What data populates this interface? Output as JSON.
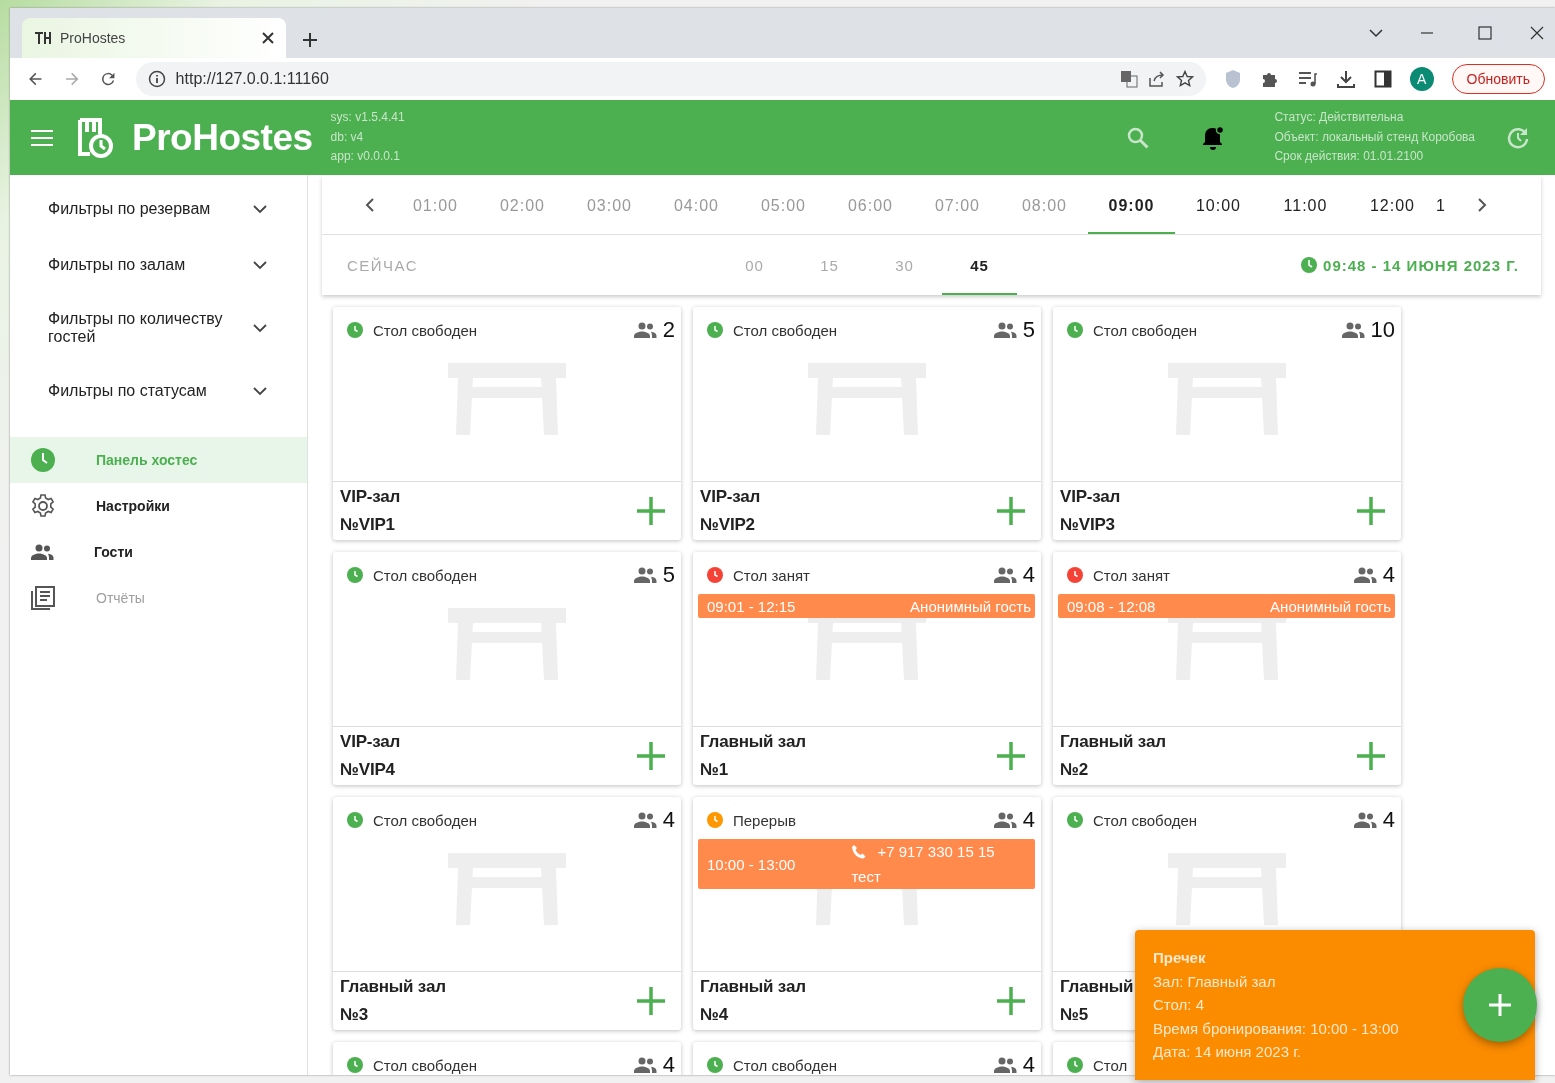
{
  "browser": {
    "tab_title": "ProHostes",
    "url": "http://127.0.0.1:11160",
    "profile_initial": "A",
    "update_button": "Обновить"
  },
  "header": {
    "app_name": "ProHostes",
    "versions": [
      "sys: v1.5.4.41",
      "db: v4",
      "app: v0.0.0.1"
    ],
    "license": [
      "Статус: Действительна",
      "Объект: локальный стенд Коробова",
      "Срок действия: 01.01.2100"
    ]
  },
  "sidebar": {
    "filters": [
      {
        "label": "Фильтры по резервам",
        "expanded": false
      },
      {
        "label": "Фильтры по залам",
        "expanded": false
      },
      {
        "label": "Фильтры по количеству гостей",
        "expanded": false
      },
      {
        "label": "Фильтры по статусам",
        "expanded": false
      }
    ],
    "nav": [
      {
        "kind": "clock",
        "label": "Панель хостес",
        "selected": true,
        "disabled": false
      },
      {
        "kind": "gear",
        "label": "Настройки",
        "selected": false,
        "disabled": false
      },
      {
        "kind": "people",
        "label": "Гости",
        "selected": false,
        "disabled": false
      },
      {
        "kind": "report",
        "label": "Отчёты",
        "selected": false,
        "disabled": true
      }
    ]
  },
  "timeline": {
    "hours": [
      {
        "label": "01:00",
        "past": true,
        "selected": false
      },
      {
        "label": "02:00",
        "past": true,
        "selected": false
      },
      {
        "label": "03:00",
        "past": true,
        "selected": false
      },
      {
        "label": "04:00",
        "past": true,
        "selected": false
      },
      {
        "label": "05:00",
        "past": true,
        "selected": false
      },
      {
        "label": "06:00",
        "past": true,
        "selected": false
      },
      {
        "label": "07:00",
        "past": true,
        "selected": false
      },
      {
        "label": "08:00",
        "past": true,
        "selected": false
      },
      {
        "label": "09:00",
        "past": false,
        "selected": true
      },
      {
        "label": "10:00",
        "past": false,
        "selected": false
      },
      {
        "label": "11:00",
        "past": false,
        "selected": false
      },
      {
        "label": "12:00",
        "past": false,
        "selected": false
      },
      {
        "label": "1",
        "past": false,
        "selected": false
      }
    ],
    "now_label": "СЕЙЧАС",
    "minutes": [
      {
        "label": "00",
        "past": true,
        "selected": false
      },
      {
        "label": "15",
        "past": true,
        "selected": false
      },
      {
        "label": "30",
        "past": true,
        "selected": false
      },
      {
        "label": "45",
        "past": false,
        "selected": true
      }
    ],
    "current": "09:48 - 14 ИЮНЯ 2023 Г."
  },
  "tables": [
    {
      "status": "Стол свободен",
      "color": "#4caf50",
      "guests": "2",
      "hall": "VIP-зал",
      "number": "№VIP1"
    },
    {
      "status": "Стол свободен",
      "color": "#4caf50",
      "guests": "5",
      "hall": "VIP-зал",
      "number": "№VIP2"
    },
    {
      "status": "Стол свободен",
      "color": "#4caf50",
      "guests": "10",
      "hall": "VIP-зал",
      "number": "№VIP3"
    },
    {
      "status": "Стол свободен",
      "color": "#4caf50",
      "guests": "5",
      "hall": "VIP-зал",
      "number": "№VIP4"
    },
    {
      "status": "Стол занят",
      "color": "#f44336",
      "guests": "4",
      "hall": "Главный зал",
      "number": "№1",
      "booking": {
        "time": "09:01 - 12:15",
        "guest": "Анонимный гость"
      }
    },
    {
      "status": "Стол занят",
      "color": "#f44336",
      "guests": "4",
      "hall": "Главный зал",
      "number": "№2",
      "booking": {
        "time": "09:08 - 12:08",
        "guest": "Анонимный гость"
      }
    },
    {
      "status": "Стол свободен",
      "color": "#4caf50",
      "guests": "4",
      "hall": "Главный зал",
      "number": "№3"
    },
    {
      "status": "Перерыв",
      "color": "#ff9800",
      "guests": "4",
      "hall": "Главный зал",
      "number": "№4",
      "booking": {
        "time": "10:00 - 13:00",
        "phone": "+7 917 330 15 15",
        "note": "тест"
      }
    },
    {
      "status": "Стол свободен",
      "color": "#4caf50",
      "guests": "4",
      "hall": "Главный",
      "number": "№5"
    },
    {
      "status": "Стол свободен",
      "color": "#4caf50",
      "guests": "4"
    },
    {
      "status": "Стол свободен",
      "color": "#4caf50",
      "guests": "4"
    },
    {
      "status": "Стол",
      "color": "#4caf50"
    }
  ],
  "notification": {
    "title": "Пречек",
    "lines": [
      "Зал: Главный зал",
      "Стол: 4",
      "Время бронирования: 10:00 - 13:00",
      "Дата: 14 июня 2023 г."
    ]
  }
}
